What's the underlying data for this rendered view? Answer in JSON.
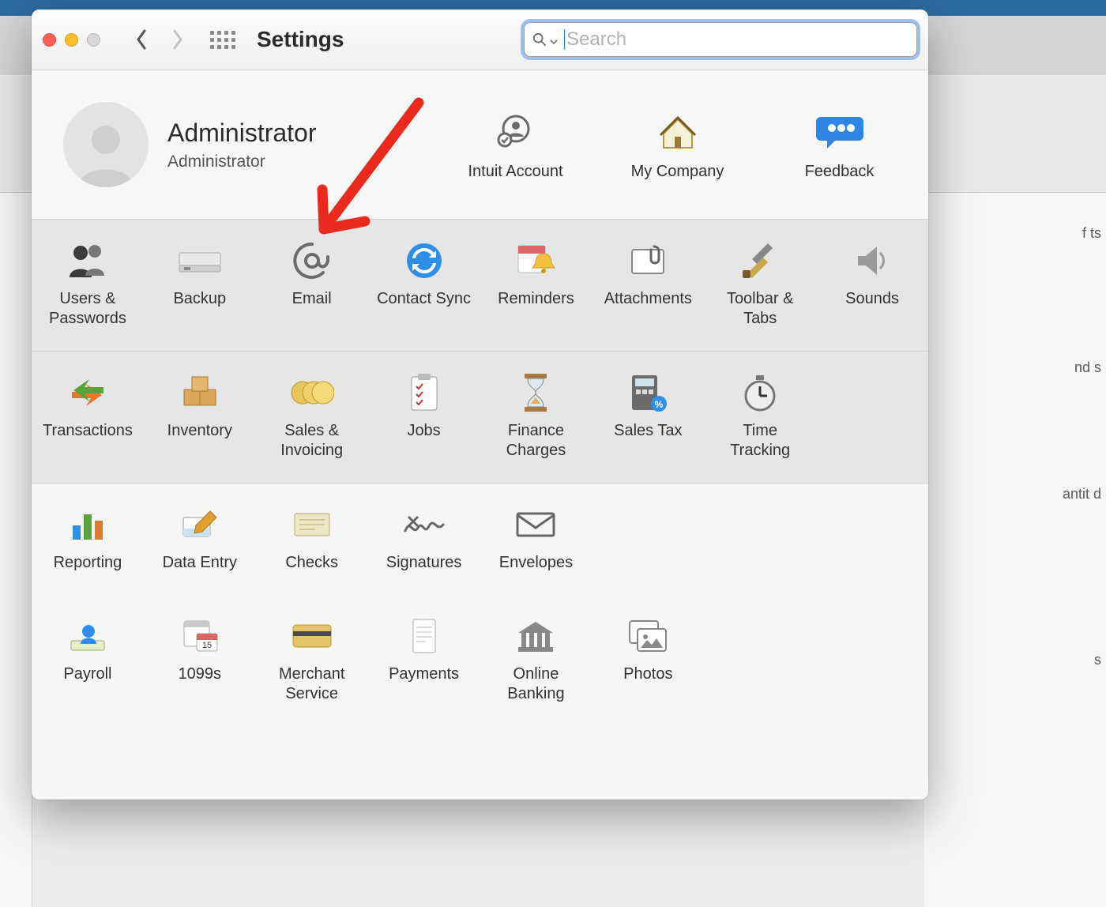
{
  "window": {
    "title": "Settings"
  },
  "search": {
    "placeholder": "Search"
  },
  "user": {
    "name": "Administrator",
    "role": "Administrator"
  },
  "headerItems": [
    {
      "id": "intuit-account",
      "label": "Intuit Account"
    },
    {
      "id": "my-company",
      "label": "My Company"
    },
    {
      "id": "feedback",
      "label": "Feedback"
    }
  ],
  "rows": [
    [
      {
        "id": "users-passwords",
        "label": "Users &\nPasswords"
      },
      {
        "id": "backup",
        "label": "Backup"
      },
      {
        "id": "email",
        "label": "Email"
      },
      {
        "id": "contact-sync",
        "label": "Contact Sync"
      },
      {
        "id": "reminders",
        "label": "Reminders"
      },
      {
        "id": "attachments",
        "label": "Attachments"
      },
      {
        "id": "toolbar-tabs",
        "label": "Toolbar &\nTabs"
      },
      {
        "id": "sounds",
        "label": "Sounds"
      }
    ],
    [
      {
        "id": "transactions",
        "label": "Transactions"
      },
      {
        "id": "inventory",
        "label": "Inventory"
      },
      {
        "id": "sales-invoicing",
        "label": "Sales &\nInvoicing"
      },
      {
        "id": "jobs",
        "label": "Jobs"
      },
      {
        "id": "finance-charges",
        "label": "Finance\nCharges"
      },
      {
        "id": "sales-tax",
        "label": "Sales Tax"
      },
      {
        "id": "time-tracking",
        "label": "Time\nTracking"
      }
    ],
    [
      {
        "id": "reporting",
        "label": "Reporting"
      },
      {
        "id": "data-entry",
        "label": "Data Entry"
      },
      {
        "id": "checks",
        "label": "Checks"
      },
      {
        "id": "signatures",
        "label": "Signatures"
      },
      {
        "id": "envelopes",
        "label": "Envelopes"
      }
    ],
    [
      {
        "id": "payroll",
        "label": "Payroll"
      },
      {
        "id": "1099s",
        "label": "1099s"
      },
      {
        "id": "merchant-service",
        "label": "Merchant\nService"
      },
      {
        "id": "payments",
        "label": "Payments"
      },
      {
        "id": "online-banking",
        "label": "Online\nBanking"
      },
      {
        "id": "photos",
        "label": "Photos"
      }
    ]
  ],
  "bgHints": {
    "h1": "f\nts",
    "h2": "nd\ns",
    "h3": "antit\nd",
    "h4": "s"
  }
}
